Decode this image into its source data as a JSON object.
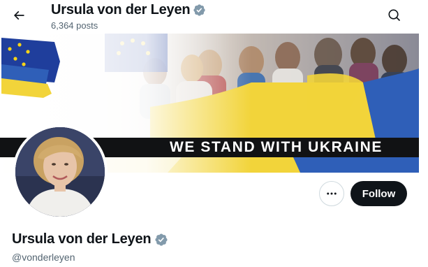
{
  "header": {
    "title": "Ursula von der Leyen",
    "posts_count": "6,364 posts",
    "back_icon": "arrow-left-icon",
    "search_icon": "search-icon"
  },
  "banner": {
    "slogan": "WE STAND WITH UKRAINE",
    "colors": {
      "ukraine_blue": "#2f5fb8",
      "ukraine_yellow": "#f2d43a",
      "eu_blue": "#1f3e9c",
      "eu_star": "#f7d417"
    }
  },
  "profile": {
    "display_name": "Ursula von der Leyen",
    "handle": "@vonderleyen",
    "verified_icon": "verified-badge-icon",
    "verified_color": "#829aab"
  },
  "actions": {
    "more_icon": "more-dots-icon",
    "follow_label": "Follow"
  }
}
